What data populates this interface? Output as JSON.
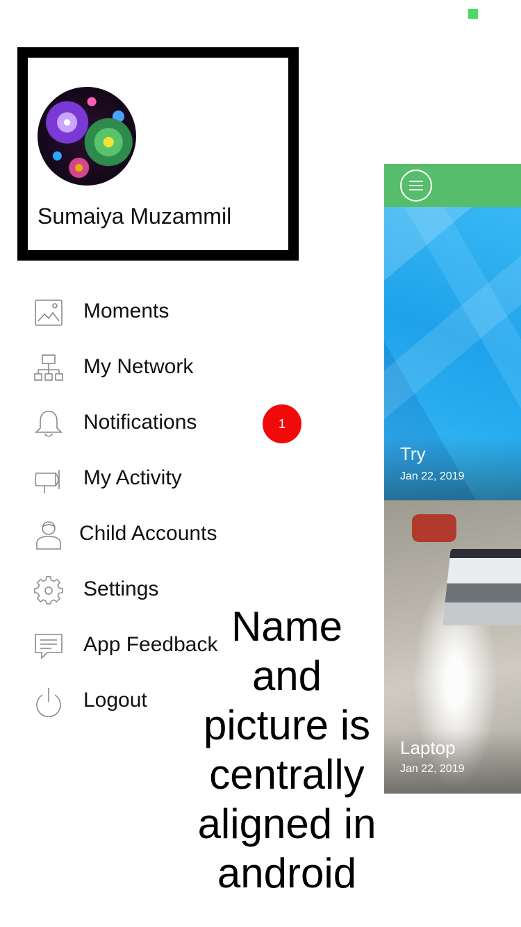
{
  "profile": {
    "name": "Sumaiya Muzammil"
  },
  "menu": {
    "items": [
      {
        "label": "Moments",
        "icon": "image-icon"
      },
      {
        "label": "My Network",
        "icon": "network-icon"
      },
      {
        "label": "Notifications",
        "icon": "bell-icon"
      },
      {
        "label": "My Activity",
        "icon": "megaphone-icon"
      },
      {
        "label": "Child Accounts",
        "icon": "user-icon"
      },
      {
        "label": "Settings",
        "icon": "gear-icon"
      },
      {
        "label": "App Feedback",
        "icon": "feedback-icon"
      },
      {
        "label": "Logout",
        "icon": "power-icon"
      }
    ],
    "notifications_badge": "1"
  },
  "annotation": {
    "lines": [
      "Name",
      "and",
      "picture is",
      "centrally",
      "aligned in",
      "android"
    ]
  },
  "feed": {
    "cards": [
      {
        "title": "Try",
        "date": "Jan 22, 2019"
      },
      {
        "title": "Laptop",
        "date": "Jan 22, 2019"
      }
    ]
  },
  "colors": {
    "accent_green": "#55bd6c",
    "badge_red": "#f10a0a",
    "status_green": "#4cd964"
  }
}
